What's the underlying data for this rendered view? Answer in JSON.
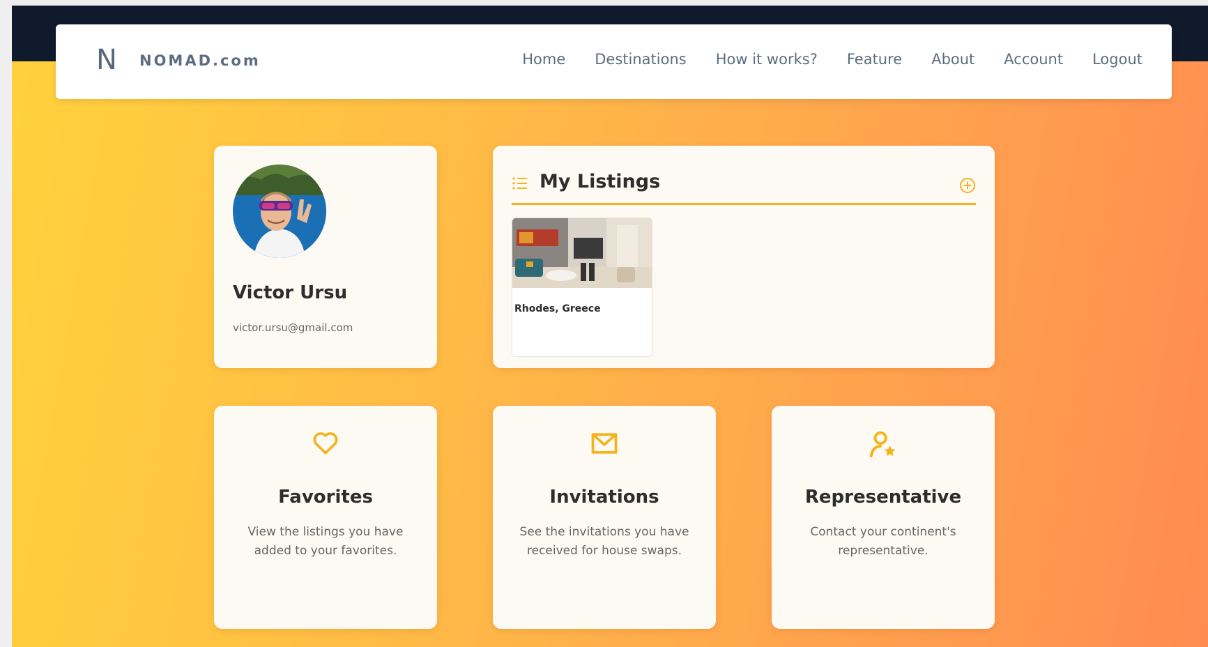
{
  "nav": {
    "logo_mark": "N",
    "logo_text": "NOMAD.com",
    "links": [
      "Home",
      "Destinations",
      "How it works?",
      "Feature",
      "About",
      "Account",
      "Logout"
    ]
  },
  "profile": {
    "name": "Victor Ursu",
    "email": "victor.ursu@gmail.com",
    "avatar_icon": "user-photo"
  },
  "listings": {
    "title": "My Listings",
    "icon": "list-icon",
    "add_icon": "plus-circle-icon",
    "items": [
      {
        "title": "Rhodes, Greece",
        "photo": "apartment-interior-photo"
      }
    ]
  },
  "features": [
    {
      "icon": "heart-icon",
      "title": "Favorites",
      "desc": "View the listings you have added to your favorites."
    },
    {
      "icon": "mail-icon",
      "title": "Invitations",
      "desc": "See the invitations you have received for house swaps."
    },
    {
      "icon": "user-star-icon",
      "title": "Representative",
      "desc": "Contact your continent's representative."
    }
  ],
  "colors": {
    "accent": "#f5b21a",
    "navy": "#0f1a2c",
    "gradient_start": "#ffd23c",
    "gradient_end": "#ff8b50"
  }
}
